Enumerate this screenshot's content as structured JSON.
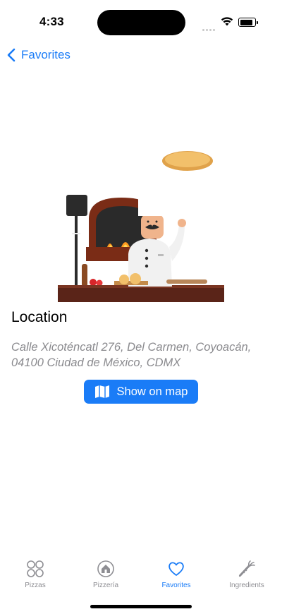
{
  "status_bar": {
    "time": "4:33"
  },
  "nav": {
    "back_label": "Favorites"
  },
  "location": {
    "title": "Location",
    "address": "Calle Xicoténcatl 276, Del Carmen, Coyoacán, 04100 Ciudad de México, CDMX",
    "map_button_label": "Show on map"
  },
  "tab_bar": {
    "tabs": [
      {
        "label": "Pizzas",
        "icon": "four-circles-icon",
        "active": false
      },
      {
        "label": "Pizzería",
        "icon": "house-circle-icon",
        "active": false
      },
      {
        "label": "Favorites",
        "icon": "heart-icon",
        "active": true
      },
      {
        "label": "Ingredients",
        "icon": "carrot-icon",
        "active": false
      }
    ]
  },
  "colors": {
    "accent": "#1a7cf7",
    "inactive": "#8e8e93",
    "address": "#8a8a8e"
  }
}
